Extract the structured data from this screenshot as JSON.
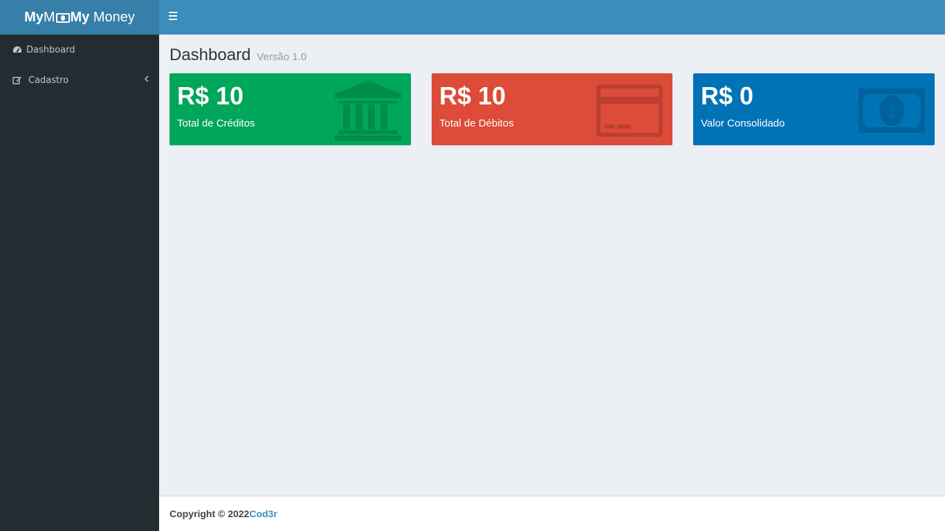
{
  "brand": {
    "part1": "My",
    "part2": "M",
    "part3": "My",
    "part4": "Money"
  },
  "sidebar": {
    "items": [
      {
        "label": "Dashboard",
        "icon": "dashboard-icon"
      },
      {
        "label": "Cadastro",
        "icon": "edit-icon"
      }
    ]
  },
  "header": {
    "toggle_icon": "bars-icon"
  },
  "page": {
    "title": "Dashboard",
    "subtitle": "Versão 1.0"
  },
  "cards": [
    {
      "value": "R$ 10",
      "label": "Total de Créditos",
      "icon": "bank-icon",
      "color": "#00a65a"
    },
    {
      "value": "R$ 10",
      "label": "Total de Débitos",
      "icon": "credit-card-icon",
      "color": "#dd4b39"
    },
    {
      "value": "R$ 0",
      "label": "Valor Consolidado",
      "icon": "money-icon",
      "color": "#0073b7"
    }
  ],
  "footer": {
    "copyright": "Copyright © 2022",
    "link": "Cod3r"
  }
}
